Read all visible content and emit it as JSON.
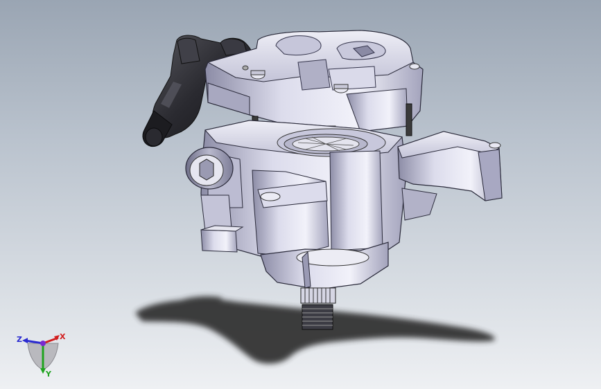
{
  "view": {
    "type": "3D CAD model viewport",
    "background_top": "#9aa5b3",
    "background_bottom": "#eef0f3",
    "model_color": "#d4d4e6",
    "model_shadow_color": "#8a8aa6",
    "connector_color": "#2e2e33"
  },
  "triad": {
    "x_label": "X",
    "y_label": "Y",
    "z_label": "Z",
    "x_color": "#d21f1f",
    "y_color": "#1fa31f",
    "z_color": "#2a2ad0"
  }
}
